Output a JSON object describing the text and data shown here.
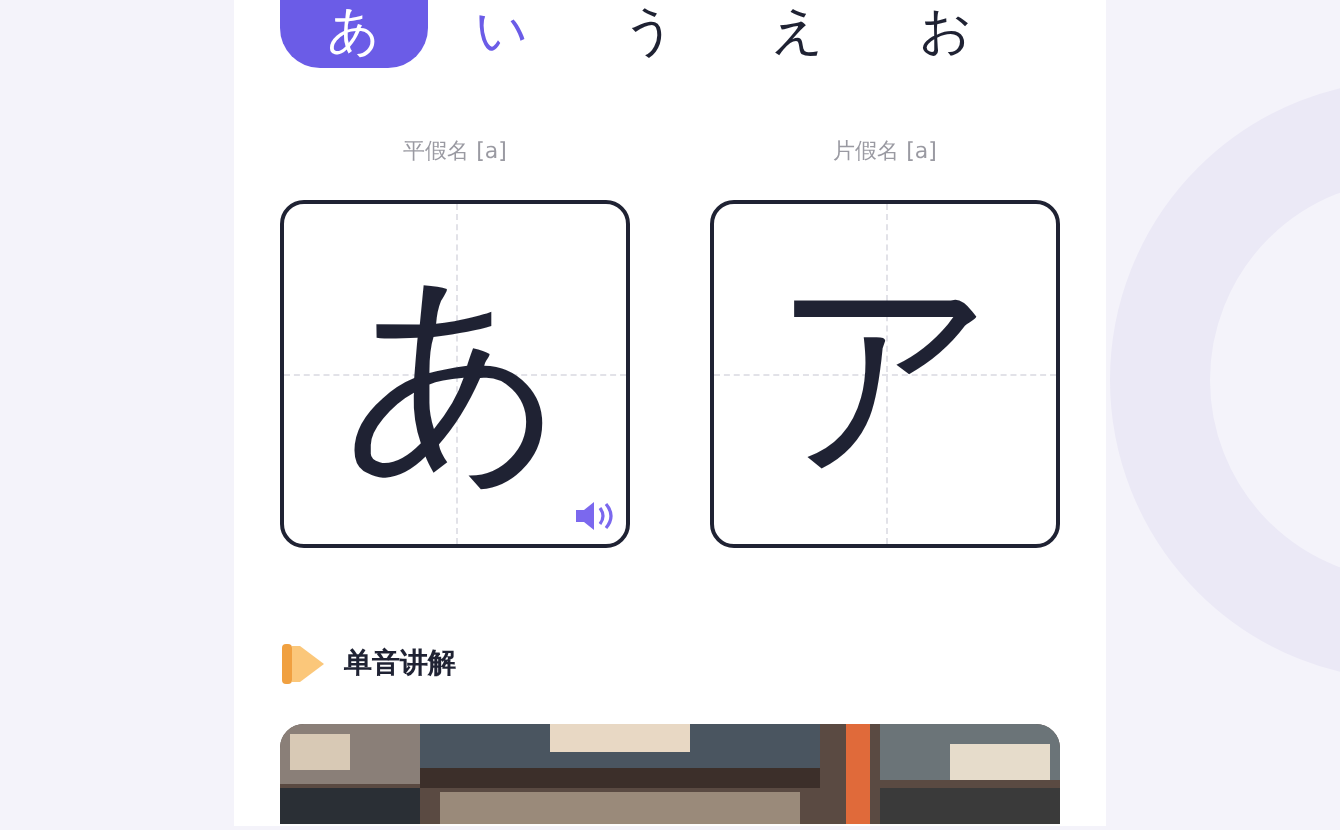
{
  "tabs": [
    {
      "label": "あ",
      "selected": true,
      "color": "#ffffff"
    },
    {
      "label": "い",
      "selected": false,
      "color": "#6b5ce7"
    },
    {
      "label": "う",
      "selected": false,
      "color": "#1f2233"
    },
    {
      "label": "え",
      "selected": false,
      "color": "#1f2233"
    },
    {
      "label": "お",
      "selected": false,
      "color": "#1f2233"
    }
  ],
  "cards": [
    {
      "caption": "平假名 [a]",
      "char": "あ",
      "sound": true
    },
    {
      "caption": "片假名 [a]",
      "char": "ア",
      "sound": false
    }
  ],
  "section": {
    "title": "单音讲解"
  }
}
